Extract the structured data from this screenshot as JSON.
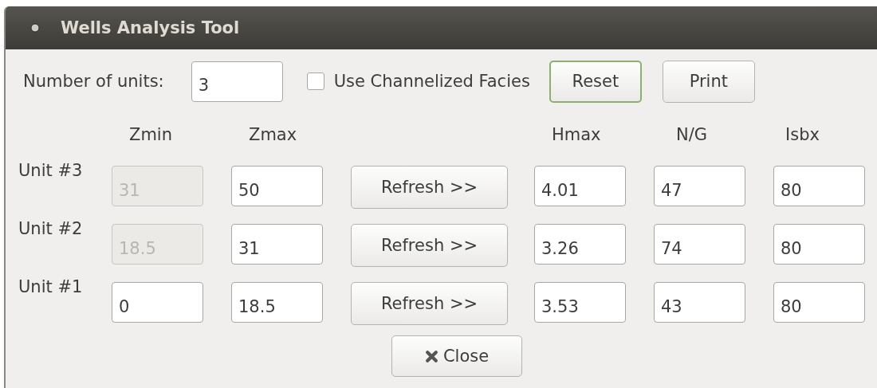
{
  "window": {
    "title": "Wells Analysis Tool"
  },
  "number_of_units": {
    "label": "Number of units:",
    "value": "3"
  },
  "channelized": {
    "label": "Use Channelized Facies",
    "checked": false
  },
  "buttons": [
    {
      "label": "Reset",
      "focused": true
    },
    {
      "label": "Print",
      "focused": false
    }
  ],
  "columns": {
    "zmin": "Zmin",
    "zmax": "Zmax",
    "hmax": "Hmax",
    "ng": "N/G",
    "isbx": "Isbx"
  },
  "units": [
    {
      "label": "Unit #3",
      "zmin": "31",
      "zmin_disabled": true,
      "zmax": "50",
      "refresh": "Refresh >>",
      "hmax": "4.01",
      "ng": "47",
      "isbx": "80"
    },
    {
      "label": "Unit #2",
      "zmin": "18.5",
      "zmin_disabled": true,
      "zmax": "31",
      "refresh": "Refresh >>",
      "hmax": "3.26",
      "ng": "74",
      "isbx": "80"
    },
    {
      "label": "Unit #1",
      "zmin": "0",
      "zmin_disabled": false,
      "zmax": "18.5",
      "refresh": "Refresh >>",
      "hmax": "3.53",
      "ng": "43",
      "isbx": "80"
    }
  ],
  "close_button": {
    "label": "Close"
  }
}
